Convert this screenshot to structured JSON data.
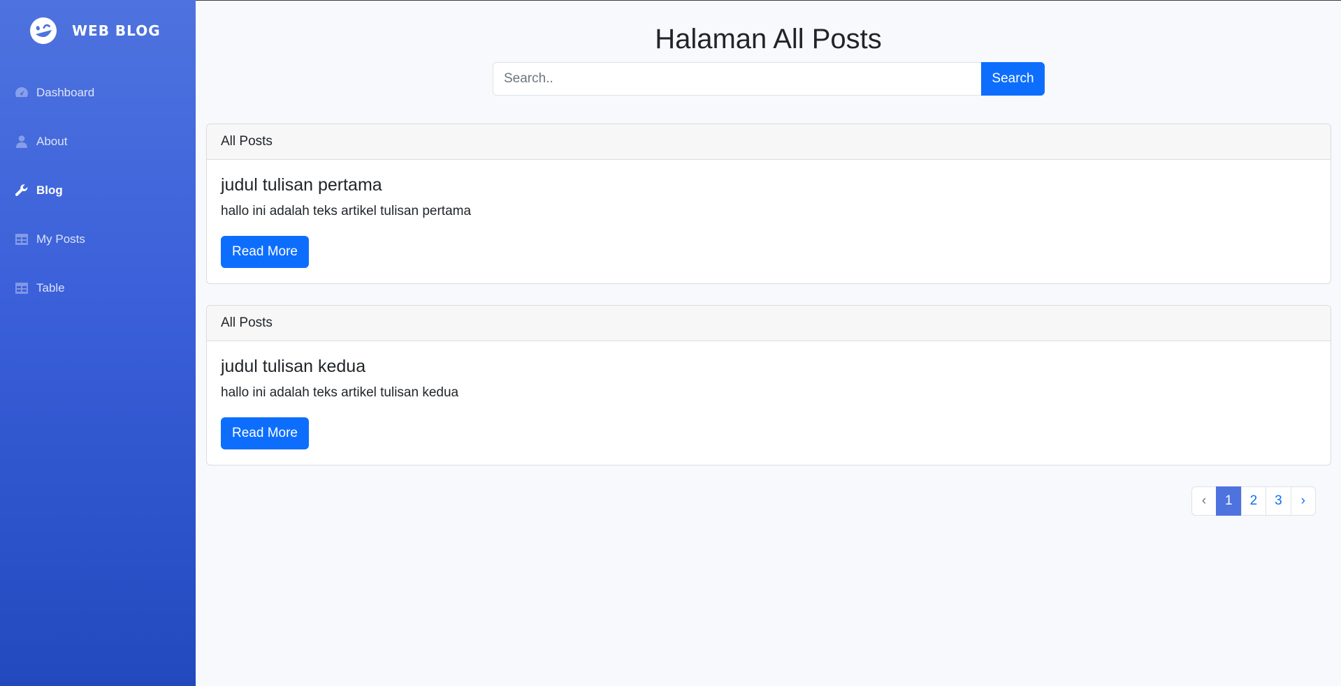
{
  "brand": {
    "name": "WEB BLOG",
    "icon": "laugh-wink-icon"
  },
  "sidebar": {
    "items": [
      {
        "label": "Dashboard",
        "icon": "tachometer-icon",
        "active": false
      },
      {
        "label": "About",
        "icon": "user-icon",
        "active": false
      },
      {
        "label": "Blog",
        "icon": "wrench-icon",
        "active": true
      },
      {
        "label": "My Posts",
        "icon": "table-icon",
        "active": false
      },
      {
        "label": "Table",
        "icon": "table-icon",
        "active": false
      }
    ]
  },
  "main": {
    "title": "Halaman All Posts",
    "search": {
      "placeholder": "Search..",
      "value": "",
      "button_label": "Search"
    },
    "posts": [
      {
        "header": "All Posts",
        "title": "judul tulisan pertama",
        "text": "hallo ini adalah teks artikel tulisan pertama",
        "button_label": "Read More"
      },
      {
        "header": "All Posts",
        "title": "judul tulisan kedua",
        "text": "hallo ini adalah teks artikel tulisan kedua",
        "button_label": "Read More"
      }
    ],
    "pagination": {
      "prev": "‹",
      "pages": [
        "1",
        "2",
        "3"
      ],
      "active": "1",
      "next": "›"
    }
  },
  "colors": {
    "sidebar_top": "#4e73df",
    "sidebar_bottom": "#224abe",
    "primary": "#0d6efd",
    "active_page": "#4e73df"
  }
}
